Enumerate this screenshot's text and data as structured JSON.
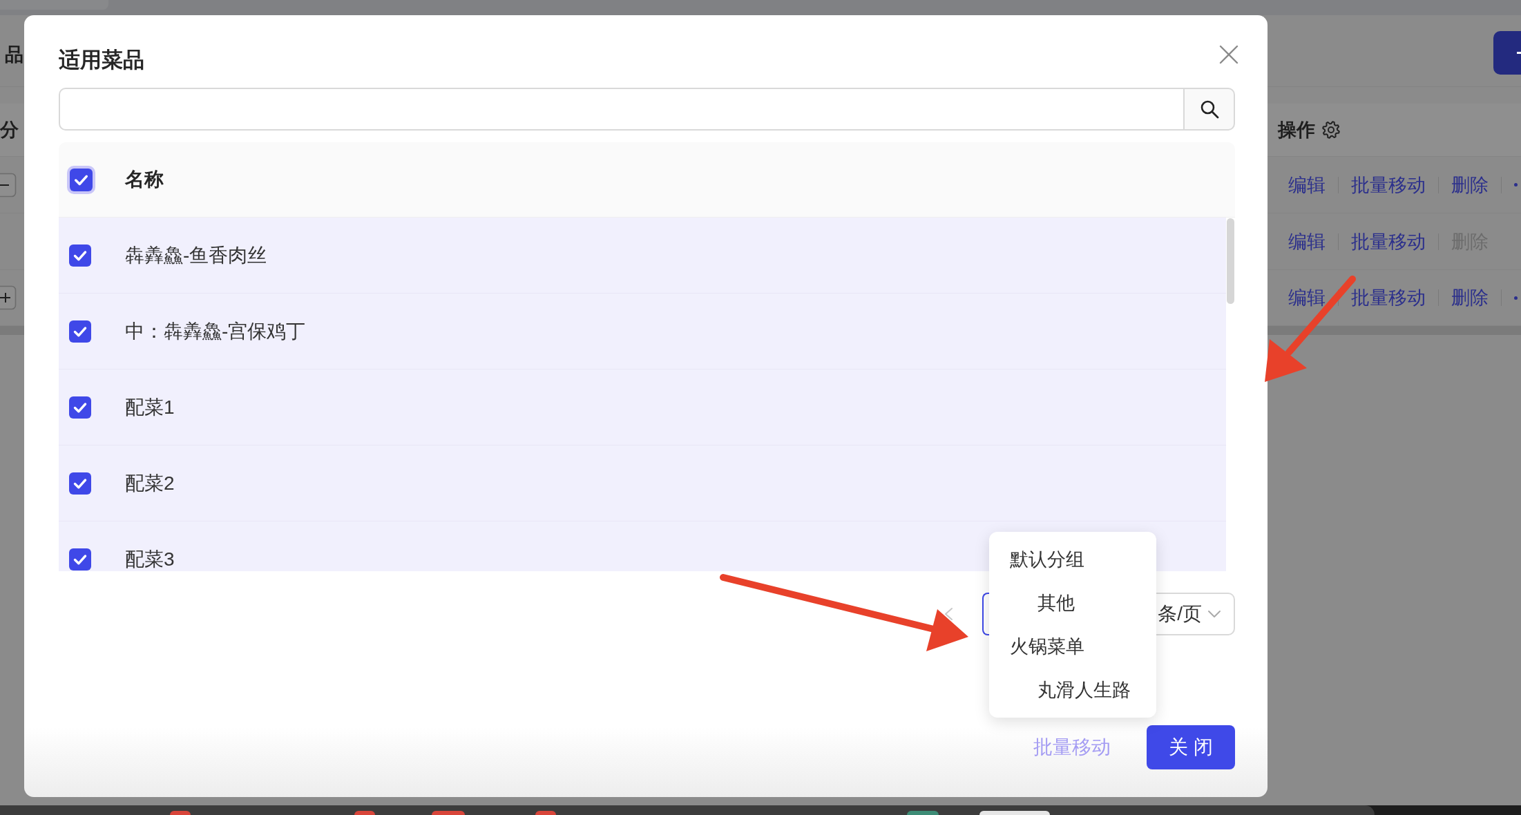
{
  "background_page": {
    "heading": "品",
    "table": {
      "columns": [
        {
          "label": "分"
        },
        {
          "label": "操作"
        }
      ],
      "rows": [
        {
          "kind": "parent",
          "expanded": true,
          "actions": [
            {
              "label": "编辑",
              "disabled": false
            },
            {
              "label": "批量移动",
              "disabled": false
            },
            {
              "label": "删除",
              "disabled": false
            }
          ],
          "more": true
        },
        {
          "kind": "leaf",
          "actions": [
            {
              "label": "编辑",
              "disabled": false
            },
            {
              "label": "批量移动",
              "disabled": false
            },
            {
              "label": "删除",
              "disabled": true
            }
          ],
          "more": false
        },
        {
          "kind": "parent",
          "expanded": false,
          "actions": [
            {
              "label": "编辑",
              "disabled": false
            },
            {
              "label": "批量移动",
              "disabled": false
            },
            {
              "label": "删除",
              "disabled": false
            }
          ],
          "more": true
        }
      ]
    }
  },
  "dialog": {
    "title": "适用菜品",
    "table": {
      "header": {
        "label": "名称",
        "checked": true,
        "focused": true
      },
      "rows": [
        {
          "name": "犇羴鱻-鱼香肉丝",
          "checked": true
        },
        {
          "name": "中：犇羴鱻-宫保鸡丁",
          "checked": true
        },
        {
          "name": "配菜1",
          "checked": true
        },
        {
          "name": "配菜2",
          "checked": true
        },
        {
          "name": "配菜3",
          "checked": true
        }
      ]
    },
    "pagination": {
      "prev_disabled": true,
      "page_size": "条/页"
    },
    "dropdown": {
      "items": [
        {
          "label": "默认分组",
          "children": [
            {
              "label": "其他"
            }
          ]
        },
        {
          "label": "火锅菜单",
          "children": [
            {
              "label": "丸滑人生路"
            }
          ]
        }
      ]
    },
    "footer": {
      "buttons": [
        {
          "label": "批量移动",
          "kind": "link",
          "disabled": true
        },
        {
          "label": "关 闭",
          "kind": "primary",
          "disabled": false
        }
      ]
    }
  }
}
